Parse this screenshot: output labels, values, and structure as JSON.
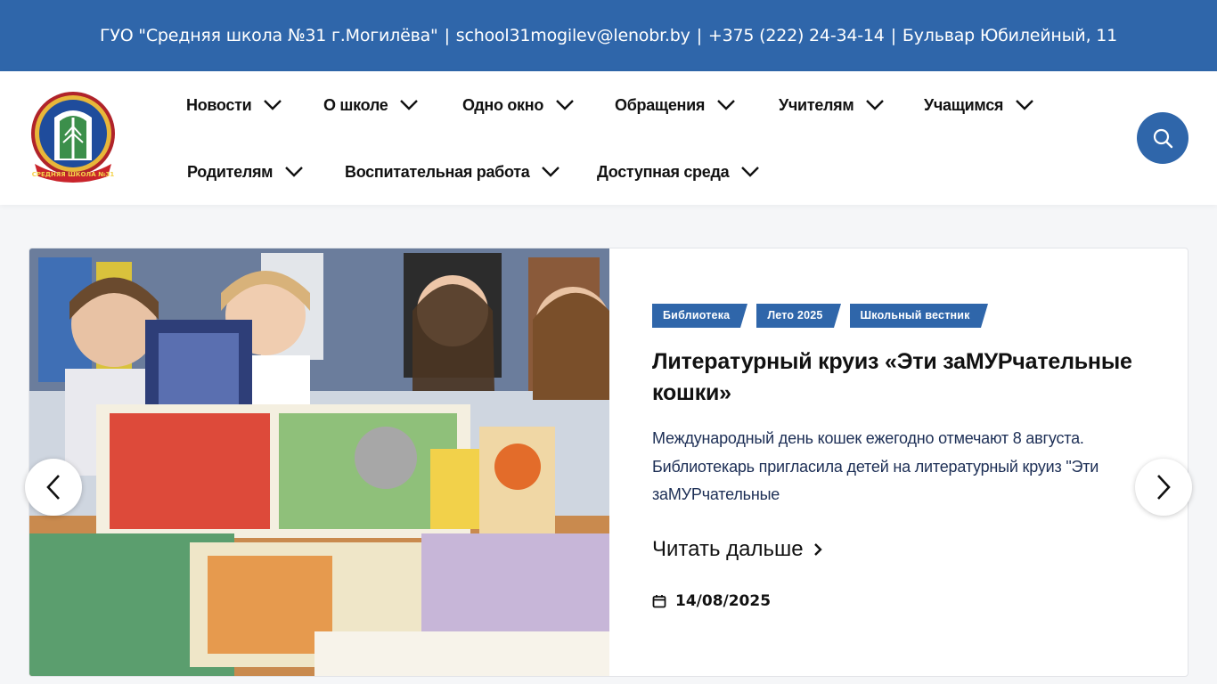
{
  "topbar": {
    "school": "ГУО \"Средняя школа №31 г.Могилёва\"",
    "email": "school31mogilev@lenobr.by",
    "phone": "+375 (222) 24-34-14",
    "address": "Бульвар Юбилейный, 11",
    "separator": "|"
  },
  "logo": {
    "ribbon_text": "СРЕДНЯЯ ШКОЛА №31"
  },
  "nav": {
    "items": [
      {
        "label": "Новости"
      },
      {
        "label": "О школе"
      },
      {
        "label": "Одно окно"
      },
      {
        "label": "Обращения"
      },
      {
        "label": "Учителям"
      },
      {
        "label": "Учащимся"
      },
      {
        "label": "Родителям"
      },
      {
        "label": "Воспитательная работа"
      },
      {
        "label": "Доступная среда"
      }
    ]
  },
  "slide": {
    "tags": [
      "Библиотека",
      "Лето 2025",
      "Школьный вестник"
    ],
    "title": "Литературный круиз «Эти заМУРчательные кошки»",
    "excerpt": "Международный день кошек ежегодно отмечают 8 августа. Библиотекарь пригласила детей на литературный круиз \"Эти заМУРчательные",
    "read_more": "Читать дальше",
    "date": "14/08/2025"
  },
  "colors": {
    "brand": "#2f66aa",
    "text": "#111111",
    "excerpt": "#1c2e55"
  },
  "icons": {
    "search": "search-icon",
    "chevron": "chevron-down-icon",
    "prev": "chevron-left-icon",
    "next": "chevron-right-icon",
    "calendar": "calendar-icon"
  }
}
